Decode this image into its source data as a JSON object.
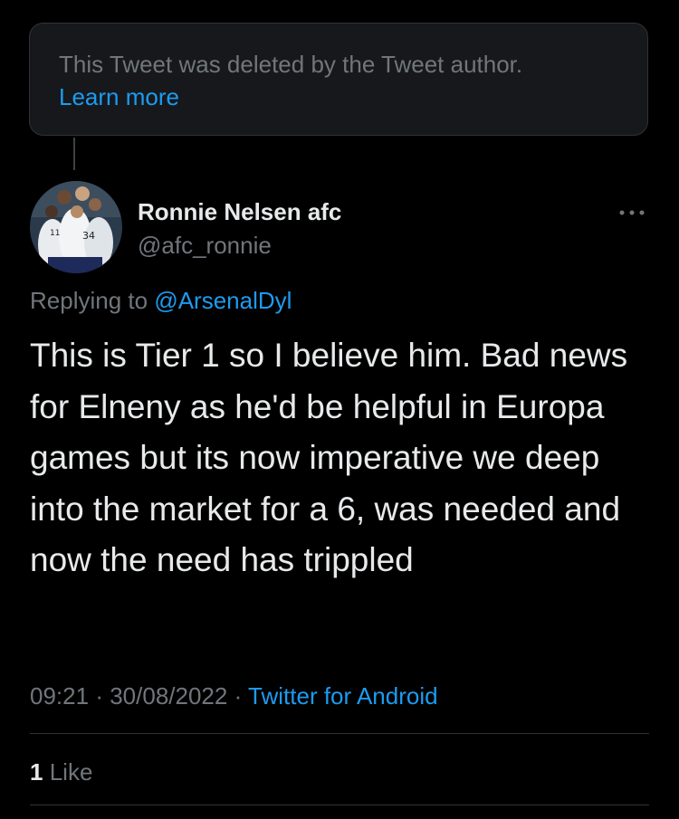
{
  "deleted_notice": {
    "text": "This Tweet was deleted by the Tweet author.",
    "link": "Learn more"
  },
  "author": {
    "display_name": "Ronnie Nelsen afc",
    "handle": "@afc_ronnie",
    "avatar_icon": "avatar-photo-players-celebrating"
  },
  "more_icon": "more-horizontal-icon",
  "reply_context": {
    "prefix": "Replying to",
    "mention": "@ArsenalDyl"
  },
  "tweet": {
    "text": "This is Tier 1 so I believe him. Bad news for Elneny as he'd be helpful in Europa games but its now imperative we deep into the market for a 6, was needed and now the need has trippled",
    "time": "09:21",
    "sep1": "·",
    "date": "30/08/2022",
    "sep2": "·",
    "source": "Twitter for Android"
  },
  "stats": {
    "like_count": "1",
    "like_label": "Like"
  },
  "colors": {
    "background": "#000000",
    "text": "#e7e9ea",
    "secondary": "#71767b",
    "accent": "#1d9bf0",
    "border": "#2f3336",
    "card": "#16181c"
  }
}
